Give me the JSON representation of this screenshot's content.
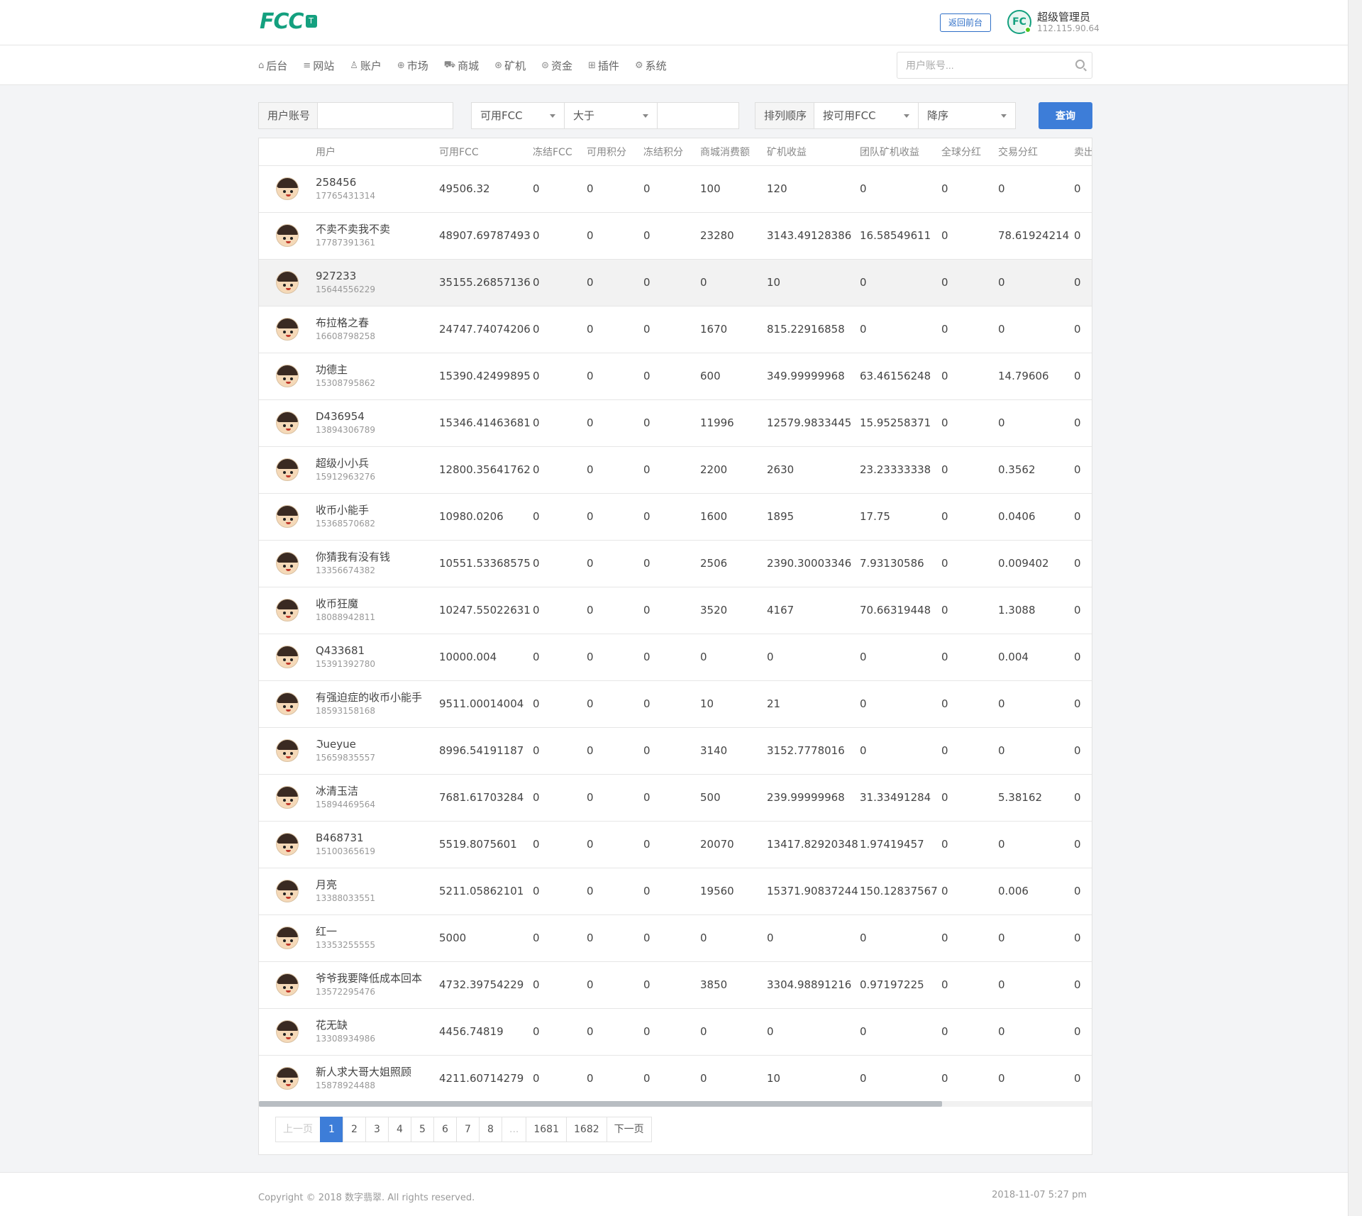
{
  "header": {
    "logo_text": "FCC",
    "logo_badge": "T",
    "front_button": "返回前台",
    "user": {
      "avatar_text": "FC",
      "name": "超级管理员",
      "ip": "112.115.90.64"
    }
  },
  "nav": {
    "items": [
      {
        "label": "后台",
        "icon": "home-icon",
        "glyph": "⌂"
      },
      {
        "label": "网站",
        "icon": "list-icon",
        "glyph": "≡"
      },
      {
        "label": "账户",
        "icon": "users-icon",
        "glyph": "♙"
      },
      {
        "label": "市场",
        "icon": "globe-icon",
        "glyph": "⊕"
      },
      {
        "label": "商城",
        "icon": "cart-icon",
        "glyph": "⛟"
      },
      {
        "label": "矿机",
        "icon": "miner-icon",
        "glyph": "⊛"
      },
      {
        "label": "资金",
        "icon": "money-icon",
        "glyph": "⊜"
      },
      {
        "label": "插件",
        "icon": "grid-icon",
        "glyph": "⊞"
      },
      {
        "label": "系统",
        "icon": "gear-icon",
        "glyph": "⚙"
      }
    ],
    "search_placeholder": "用户账号..."
  },
  "filters": {
    "account_label": "用户账号",
    "account_value": "",
    "field_select": "可用FCC",
    "compare_select": "大于",
    "compare_value": "",
    "sort_label": "排列顺序",
    "sort_field": "按可用FCC",
    "sort_order": "降序",
    "query_button": "查询"
  },
  "table": {
    "columns": [
      "",
      "用户",
      "可用FCC",
      "冻结FCC",
      "可用积分",
      "冻结积分",
      "商城消费额",
      "矿机收益",
      "团队矿机收益",
      "全球分红",
      "交易分红",
      "卖出"
    ],
    "rows": [
      {
        "name": "258456",
        "phone": "17765431314",
        "cells": [
          "49506.32",
          "0",
          "0",
          "0",
          "100",
          "120",
          "0",
          "0",
          "0",
          "0"
        ]
      },
      {
        "name": "不卖不卖我不卖",
        "phone": "17787391361",
        "cells": [
          "48907.69787493",
          "0",
          "0",
          "0",
          "23280",
          "3143.49128386",
          "16.58549611",
          "0",
          "78.61924214",
          "0"
        ]
      },
      {
        "name": "927233",
        "phone": "15644556229",
        "cells": [
          "35155.26857136",
          "0",
          "0",
          "0",
          "0",
          "10",
          "0",
          "0",
          "0",
          "0"
        ]
      },
      {
        "name": "布拉格之春",
        "phone": "16608798258",
        "cells": [
          "24747.74074206",
          "0",
          "0",
          "0",
          "1670",
          "815.22916858",
          "0",
          "0",
          "0",
          "0"
        ]
      },
      {
        "name": "功德主",
        "phone": "15308795862",
        "cells": [
          "15390.42499895",
          "0",
          "0",
          "0",
          "600",
          "349.99999968",
          "63.46156248",
          "0",
          "14.79606",
          "0"
        ]
      },
      {
        "name": "D436954",
        "phone": "13894306789",
        "cells": [
          "15346.41463681",
          "0",
          "0",
          "0",
          "11996",
          "12579.9833445",
          "15.95258371",
          "0",
          "0",
          "0"
        ]
      },
      {
        "name": "超级小小兵",
        "phone": "15912963276",
        "cells": [
          "12800.35641762",
          "0",
          "0",
          "0",
          "2200",
          "2630",
          "23.23333338",
          "0",
          "0.3562",
          "0"
        ]
      },
      {
        "name": "收币小能手",
        "phone": "15368570682",
        "cells": [
          "10980.0206",
          "0",
          "0",
          "0",
          "1600",
          "1895",
          "17.75",
          "0",
          "0.0406",
          "0"
        ]
      },
      {
        "name": "你猜我有没有钱",
        "phone": "13356674382",
        "cells": [
          "10551.53368575",
          "0",
          "0",
          "0",
          "2506",
          "2390.30003346",
          "7.93130586",
          "0",
          "0.009402",
          "0"
        ]
      },
      {
        "name": "收币狂魔",
        "phone": "18088942811",
        "cells": [
          "10247.55022631",
          "0",
          "0",
          "0",
          "3520",
          "4167",
          "70.66319448",
          "0",
          "1.3088",
          "0"
        ]
      },
      {
        "name": "Q433681",
        "phone": "15391392780",
        "cells": [
          "10000.004",
          "0",
          "0",
          "0",
          "0",
          "0",
          "0",
          "0",
          "0.004",
          "0"
        ]
      },
      {
        "name": "有强迫症的收币小能手",
        "phone": "18593158168",
        "cells": [
          "9511.00014004",
          "0",
          "0",
          "0",
          "10",
          "21",
          "0",
          "0",
          "0",
          "0"
        ]
      },
      {
        "name": "ℑueyue",
        "phone": "15659835557",
        "cells": [
          "8996.54191187",
          "0",
          "0",
          "0",
          "3140",
          "3152.7778016",
          "0",
          "0",
          "0",
          "0"
        ]
      },
      {
        "name": "冰清玉洁",
        "phone": "15894469564",
        "cells": [
          "7681.61703284",
          "0",
          "0",
          "0",
          "500",
          "239.99999968",
          "31.33491284",
          "0",
          "5.38162",
          "0"
        ]
      },
      {
        "name": "B468731",
        "phone": "15100365619",
        "cells": [
          "5519.8075601",
          "0",
          "0",
          "0",
          "20070",
          "13417.82920348",
          "1.97419457",
          "0",
          "0",
          "0"
        ]
      },
      {
        "name": "月亮",
        "phone": "13388033551",
        "cells": [
          "5211.05862101",
          "0",
          "0",
          "0",
          "19560",
          "15371.90837244",
          "150.12837567",
          "0",
          "0.006",
          "0"
        ]
      },
      {
        "name": "红一",
        "phone": "13353255555",
        "cells": [
          "5000",
          "0",
          "0",
          "0",
          "0",
          "0",
          "0",
          "0",
          "0",
          "0"
        ]
      },
      {
        "name": "爷爷我要降低成本回本",
        "phone": "13572295476",
        "cells": [
          "4732.39754229",
          "0",
          "0",
          "0",
          "3850",
          "3304.98891216",
          "0.97197225",
          "0",
          "0",
          "0"
        ]
      },
      {
        "name": "花无缺",
        "phone": "13308934986",
        "cells": [
          "4456.74819",
          "0",
          "0",
          "0",
          "0",
          "0",
          "0",
          "0",
          "0",
          "0"
        ]
      },
      {
        "name": "新人求大哥大姐照顾",
        "phone": "15878924488",
        "cells": [
          "4211.60714279",
          "0",
          "0",
          "0",
          "0",
          "10",
          "0",
          "0",
          "0",
          "0"
        ]
      }
    ],
    "hover_row": 2
  },
  "pagination": {
    "prev": "上一页",
    "pages": [
      "1",
      "2",
      "3",
      "4",
      "5",
      "6",
      "7",
      "8",
      "...",
      "1681",
      "1682"
    ],
    "active": "1",
    "next": "下一页"
  },
  "footer": {
    "copyright": "Copyright © 2018 数字翡翠. All rights reserved.",
    "time": "2018-11-07 5:27 pm"
  },
  "colors": {
    "brand": "#14a07f",
    "primary": "#3d7dd8",
    "link": "#2f6fc7"
  }
}
